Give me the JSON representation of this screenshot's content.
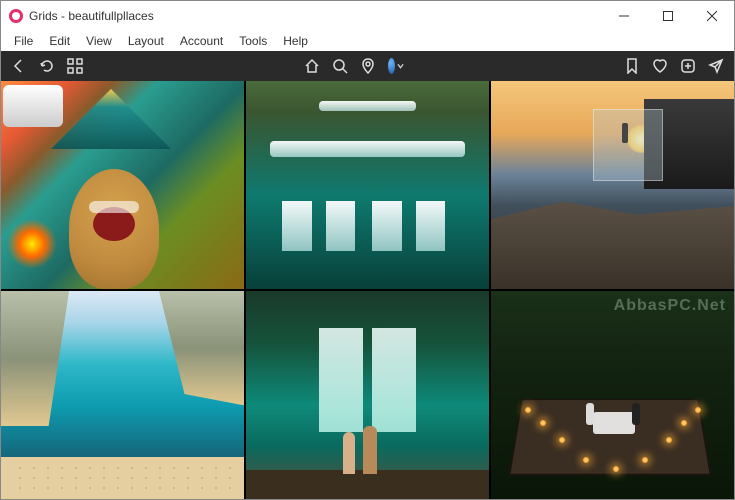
{
  "window": {
    "app_name": "Grids",
    "title_sep": " - ",
    "profile": "beautifullpllaces"
  },
  "menu": {
    "file": "File",
    "edit": "Edit",
    "view": "View",
    "layout": "Layout",
    "account": "Account",
    "tools": "Tools",
    "help": "Help"
  },
  "watermark": "AbbasPC.Net",
  "posts": [
    {
      "alt": "Golden retriever at a campsite with tent and fire pit"
    },
    {
      "alt": "Aerial view of multi-tiered tropical waterfalls"
    },
    {
      "alt": "Glass cabin on a cliff over the sea at sunset"
    },
    {
      "alt": "Turquoise cove with rocky cliffs and crowded beach"
    },
    {
      "alt": "Couple standing before twin jungle waterfalls"
    },
    {
      "alt": "Candlelit treehouse deck dinner at night"
    }
  ]
}
